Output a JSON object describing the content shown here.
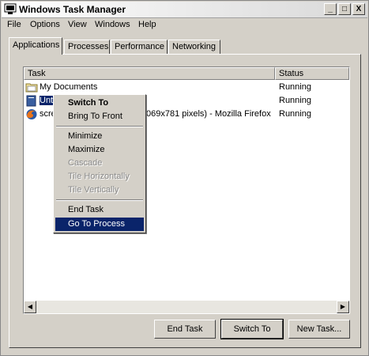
{
  "window": {
    "title": "Windows Task Manager"
  },
  "titlebar_buttons": {
    "minimize": "_",
    "maximize": "□",
    "close": "X"
  },
  "menubar": [
    "File",
    "Options",
    "View",
    "Windows",
    "Help"
  ],
  "tabs": [
    "Applications",
    "Processes",
    "Performance",
    "Networking"
  ],
  "list": {
    "columns": {
      "task": "Task",
      "status": "Status"
    },
    "rows": [
      {
        "task": "My Documents",
        "status": "Running",
        "icon": "folder-icon"
      },
      {
        "task": "Unt",
        "status": "Running",
        "icon": "document-icon"
      },
      {
        "task": "scre",
        "task_tail": "069x781 pixels) - Mozilla Firefox",
        "status": "Running",
        "icon": "firefox-icon"
      }
    ]
  },
  "context_menu": {
    "items": [
      {
        "label": "Switch To",
        "bold": true,
        "disabled": false
      },
      {
        "label": "Bring To Front",
        "disabled": false
      },
      {
        "label": "Minimize",
        "disabled": false
      },
      {
        "label": "Maximize",
        "disabled": false
      },
      {
        "label": "Cascade",
        "disabled": true
      },
      {
        "label": "Tile Horizontally",
        "disabled": true
      },
      {
        "label": "Tile Vertically",
        "disabled": true
      },
      {
        "label": "End Task",
        "disabled": false
      },
      {
        "label": "Go To Process",
        "disabled": false,
        "selected": true
      }
    ]
  },
  "buttons": {
    "end_task": "End Task",
    "switch_to": "Switch To",
    "new_task": "New Task..."
  },
  "scrollbar": {
    "left_arrow": "◀",
    "right_arrow": "▶"
  },
  "colors": {
    "window_bg": "#d4d0c8",
    "selection": "#0a246a"
  }
}
